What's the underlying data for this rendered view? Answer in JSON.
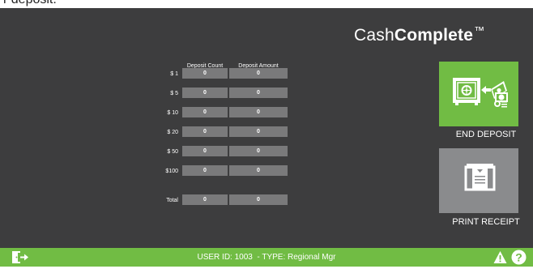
{
  "header": {
    "brand_light": "Cash",
    "brand_bold": "Complete",
    "brand_tm": "™",
    "cut_text": "r deposit."
  },
  "table": {
    "col_count_label": "Deposit Count",
    "col_amount_label": "Deposit Amount",
    "rows": [
      {
        "label": "$  1",
        "count": "0",
        "amount": "0"
      },
      {
        "label": "$  5",
        "count": "0",
        "amount": "0"
      },
      {
        "label": "$ 10",
        "count": "0",
        "amount": "0"
      },
      {
        "label": "$ 20",
        "count": "0",
        "amount": "0"
      },
      {
        "label": "$ 50",
        "count": "0",
        "amount": "0"
      },
      {
        "label": "$100",
        "count": "0",
        "amount": "0"
      }
    ],
    "total": {
      "label": "Total",
      "count": "0",
      "amount": "0"
    }
  },
  "actions": {
    "end_deposit_label": "END DEPOSIT",
    "print_receipt_label": "PRINT RECEIPT"
  },
  "footer": {
    "status_text": "USER ID: 1003  - TYPE: Regional Mgr"
  },
  "icons": {
    "end_deposit": "safe-deposit-icon",
    "print_receipt": "receipt-printer-icon",
    "exit": "exit-door-icon",
    "warning": "warning-icon",
    "help": "help-icon"
  },
  "colors": {
    "background": "#3d3d3e",
    "accent_green": "#71bc44",
    "cell_gray": "#7a7a7b",
    "button_gray": "#8a8b8d"
  }
}
